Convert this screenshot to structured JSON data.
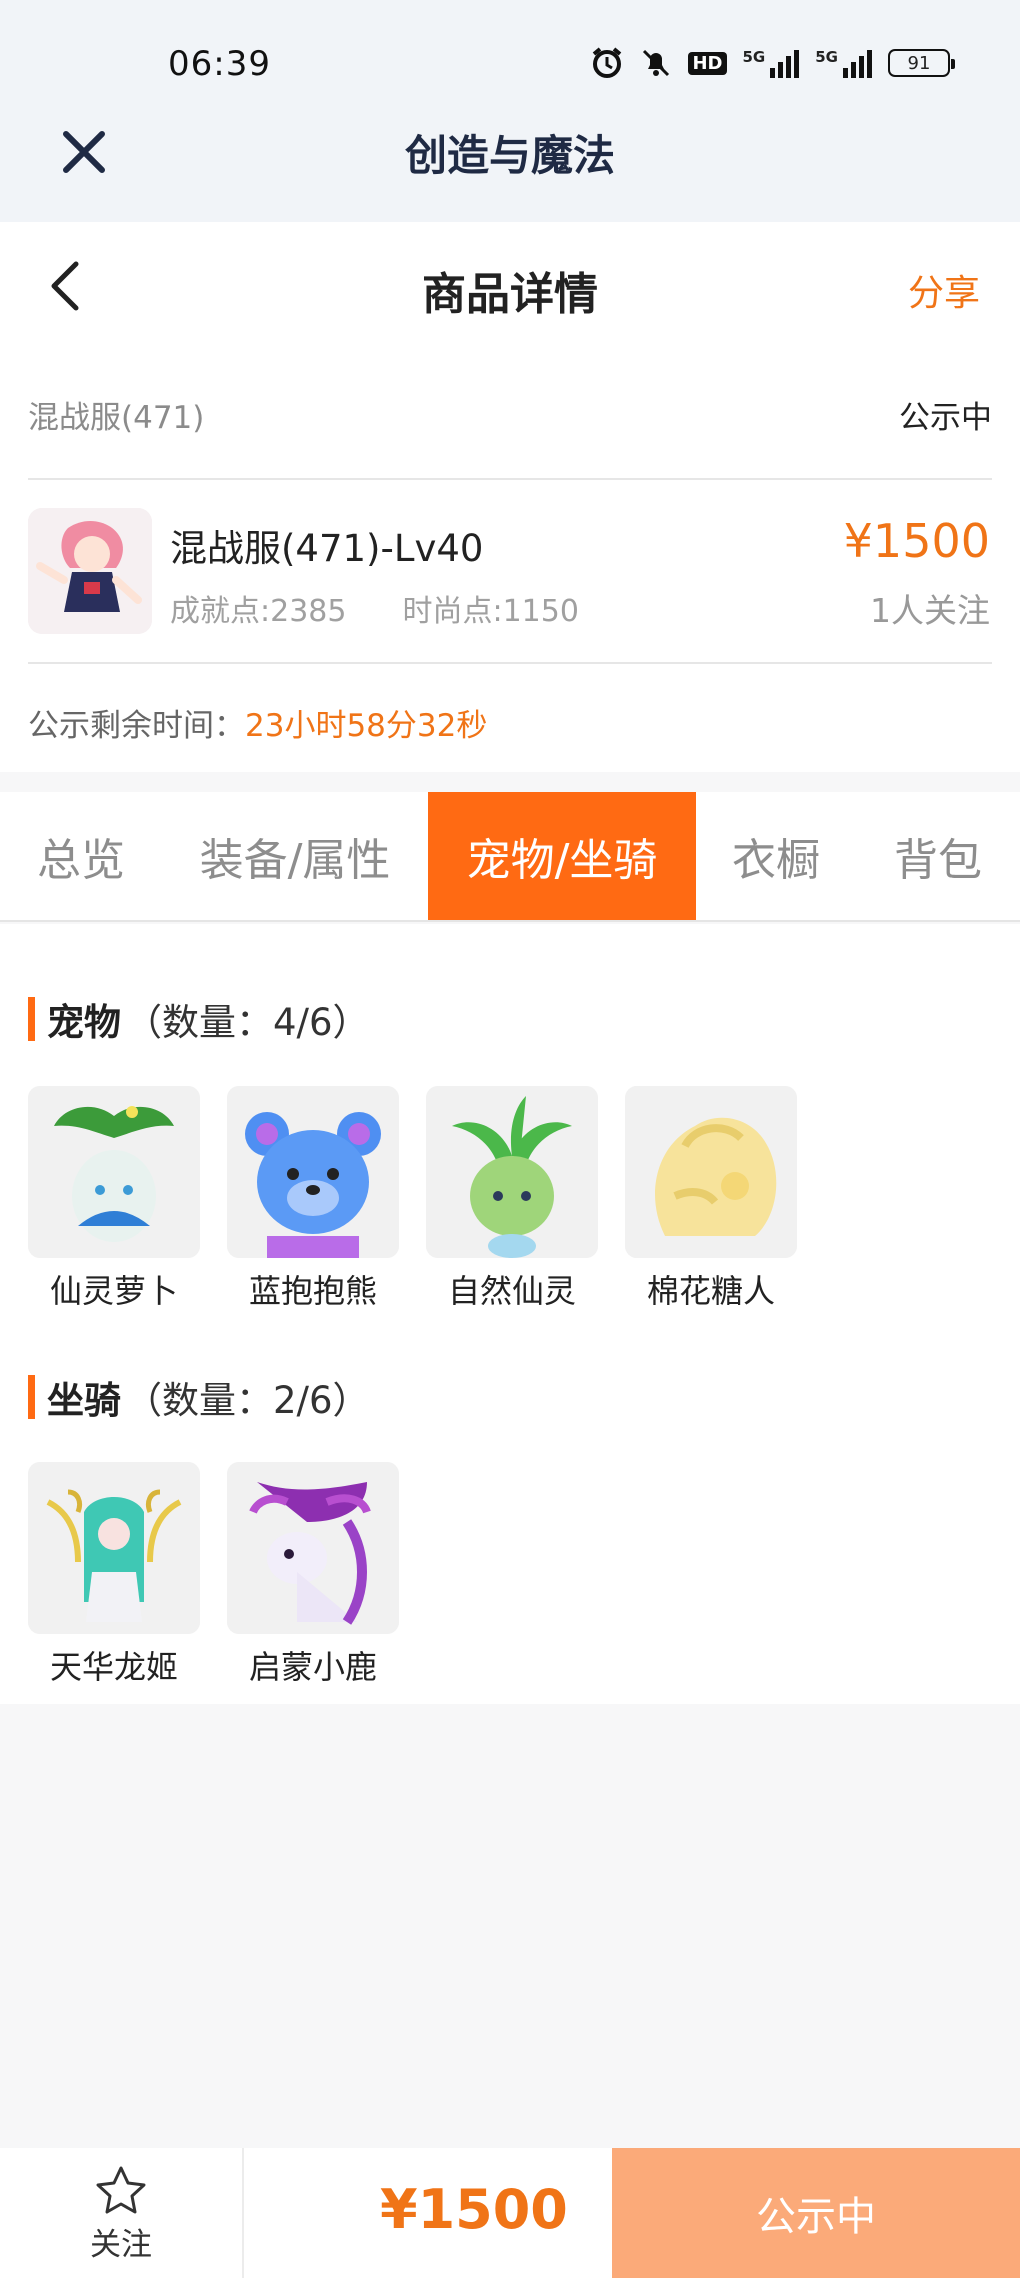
{
  "status_bar": {
    "time": "06:39",
    "hd_label": "HD",
    "signal_label_1": "5G",
    "signal_label_2": "5G",
    "battery": "91"
  },
  "app_bar": {
    "title": "创造与魔法",
    "close_icon": "close-icon"
  },
  "nav": {
    "title": "商品详情",
    "share": "分享",
    "back_icon": "chevron-left-icon"
  },
  "server": {
    "name": "混战服(471)",
    "status": "公示中"
  },
  "product": {
    "name": "混战服(471)-Lv40",
    "achievement": "成就点:2385",
    "fashion": "时尚点:1150",
    "price": "¥1500",
    "followers": "1人关注"
  },
  "countdown": {
    "label": "公示剩余时间：",
    "value": "23小时58分32秒"
  },
  "tabs": [
    {
      "label": "总览"
    },
    {
      "label": "装备/属性"
    },
    {
      "label": "宠物/坐骑"
    },
    {
      "label": "衣橱"
    },
    {
      "label": "背包"
    }
  ],
  "active_tab": 2,
  "pets": {
    "title": "宠物",
    "count": "（数量：4/6）",
    "items": [
      {
        "name": "仙灵萝卜"
      },
      {
        "name": "蓝抱抱熊"
      },
      {
        "name": "自然仙灵"
      },
      {
        "name": "棉花糖人"
      }
    ]
  },
  "mounts": {
    "title": "坐骑",
    "count": "（数量：2/6）",
    "items": [
      {
        "name": "天华龙姬"
      },
      {
        "name": "启蒙小鹿"
      }
    ]
  },
  "bottom": {
    "follow_label": "关注",
    "price": "¥1500",
    "action": "公示中"
  },
  "colors": {
    "accent": "#ff6a13",
    "price": "#f07417",
    "action_bg": "#fbaa79"
  }
}
